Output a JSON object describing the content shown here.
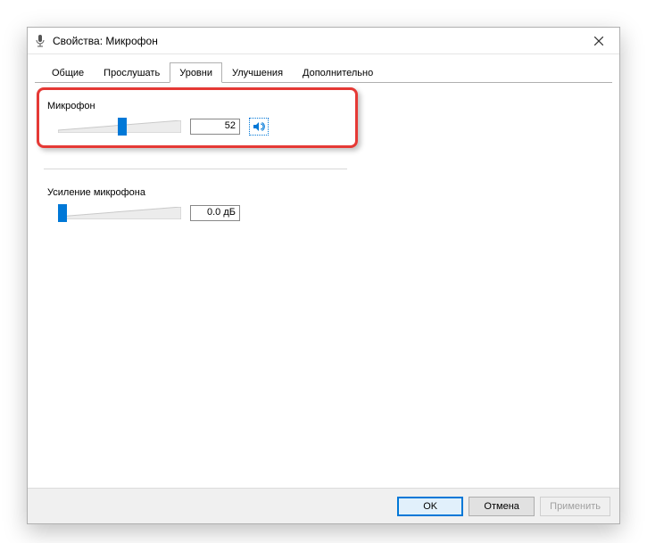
{
  "title": "Свойства: Микрофон",
  "tabs": {
    "general": "Общие",
    "listen": "Прослушать",
    "levels": "Уровни",
    "enhancements": "Улучшения",
    "advanced": "Дополнительно"
  },
  "active_tab": "levels",
  "groups": {
    "mic": {
      "label": "Микрофон",
      "value": "52",
      "percent": 52,
      "mute_icon": "speaker-icon"
    },
    "boost": {
      "label": "Усиление микрофона",
      "value": "0.0 дБ",
      "percent": 0
    }
  },
  "buttons": {
    "ok": "OK",
    "cancel": "Отмена",
    "apply": "Применить"
  }
}
